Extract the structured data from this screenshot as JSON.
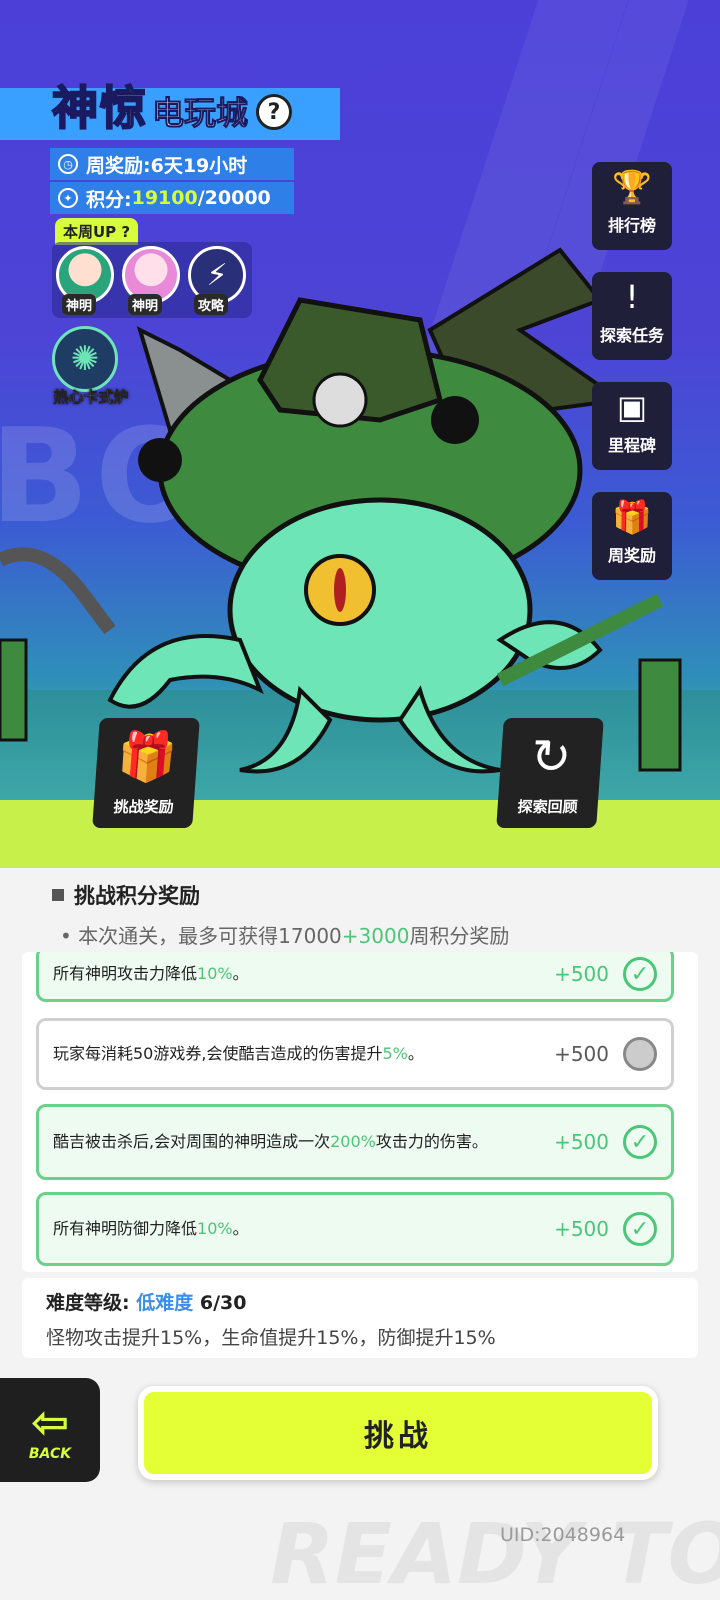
{
  "header": {
    "title_highlight": "神惊",
    "title_rest": "电玩城",
    "help_label": "?",
    "weekly_reward_label": "周奖励: ",
    "weekly_reward_time": "6天19小时",
    "points_label": "积分: ",
    "points_current": "19100",
    "points_total": "/20000"
  },
  "weekly_up": {
    "label": "本周UP",
    "help": "?",
    "items": [
      {
        "tag": "神明"
      },
      {
        "tag": "神明"
      },
      {
        "tag": "攻略"
      }
    ]
  },
  "forge": {
    "label": "热心卡式炉"
  },
  "side_menu": [
    {
      "label": "排行榜",
      "icon": "trophy-icon",
      "glyph": "🏆"
    },
    {
      "label": "探索任务",
      "icon": "exclaim-icon",
      "glyph": "!"
    },
    {
      "label": "里程碑",
      "icon": "box-icon",
      "glyph": "▣"
    },
    {
      "label": "周奖励",
      "icon": "gift-icon",
      "glyph": "🎁"
    }
  ],
  "corner_buttons": {
    "challenge_reward": {
      "label": "挑战奖励",
      "glyph": "🎁"
    },
    "explore_review": {
      "label": "探索回顾",
      "glyph": "↻"
    }
  },
  "background_text": "BO",
  "rewards": {
    "title": "挑战积分奖励",
    "subtitle_prefix": "• 本次通关，最多可获得17000",
    "subtitle_bonus": "+3000",
    "subtitle_suffix": "周积分奖励",
    "items": [
      {
        "text_a": "所有神明攻击力降低",
        "hl": "10%",
        "text_b": "。",
        "points": "+500",
        "done": true
      },
      {
        "text_a": "玩家每消耗50游戏券,会使酷吉造成的伤害提升",
        "hl": "5%",
        "text_b": "。",
        "points": "+500",
        "done": false
      },
      {
        "text_a": "酷吉被击杀后,会对周围的神明造成一次",
        "hl": "200%",
        "text_b": "攻击力的伤害。",
        "points": "+500",
        "done": true
      },
      {
        "text_a": "所有神明防御力降低",
        "hl": "10%",
        "text_b": "。",
        "points": "+500",
        "done": true
      }
    ]
  },
  "difficulty": {
    "label": "难度等级:",
    "level_name": "低难度",
    "level_progress": "6/30",
    "effects": "怪物攻击提升15%，生命值提升15%，防御提升15%"
  },
  "actions": {
    "back_label": "BACK",
    "challenge_label": "挑战"
  },
  "footer": {
    "watermark": "READY TO FIG",
    "uid": "UID:2048964"
  },
  "colors": {
    "accent_lime": "#d6ff3a",
    "accent_green": "#4bc678",
    "accent_blue": "#3a8ef0",
    "hero_bg": "#4b3fd8"
  }
}
